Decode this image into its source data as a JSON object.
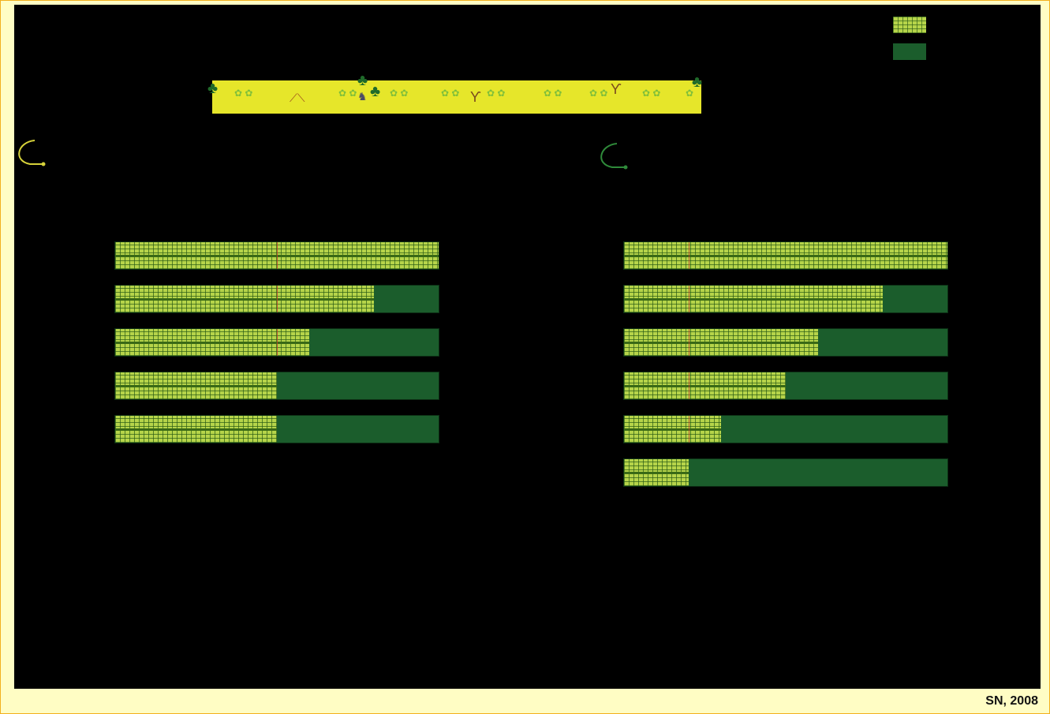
{
  "credit": "SN, 2008",
  "legend": [
    {
      "pattern": "checkered-light-green",
      "color": "#b6d44a"
    },
    {
      "pattern": "solid-dark-green",
      "color": "#1b5d2c"
    }
  ],
  "strip": {
    "color": "#e6e62a",
    "icons": [
      "palm-icon",
      "sprout-icon",
      "log-icon",
      "goat-icon",
      "tree-icon"
    ]
  },
  "chart_data": [
    {
      "type": "bar",
      "orientation": "horizontal",
      "stacked": true,
      "panel": "left",
      "series": [
        {
          "color": "#b6d44a",
          "values": [
            100,
            80,
            60,
            50,
            50
          ]
        },
        {
          "color": "#1b5d2c",
          "values": [
            0,
            20,
            40,
            50,
            50
          ]
        }
      ],
      "ylim": [
        0,
        100
      ]
    },
    {
      "type": "bar",
      "orientation": "horizontal",
      "stacked": true,
      "panel": "right",
      "series": [
        {
          "color": "#b6d44a",
          "values": [
            100,
            80,
            60,
            50,
            30,
            20
          ]
        },
        {
          "color": "#1b5d2c",
          "values": [
            0,
            20,
            40,
            50,
            70,
            80
          ]
        }
      ],
      "ylim": [
        0,
        100
      ]
    }
  ],
  "colors": {
    "background": "#000000",
    "frame": "#fffdc4",
    "border": "#f2b01e",
    "hook_left": "#d6d23a",
    "hook_right": "#2f8a3a"
  }
}
